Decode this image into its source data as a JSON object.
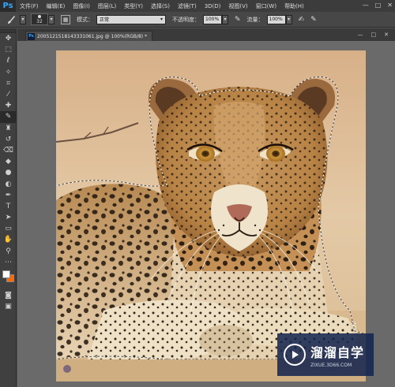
{
  "app": {
    "logo": "Ps"
  },
  "menu": [
    "文件(F)",
    "编辑(E)",
    "图像(I)",
    "图层(L)",
    "类型(Y)",
    "选择(S)",
    "滤镜(T)",
    "3D(D)",
    "视图(V)",
    "窗口(W)",
    "帮助(H)"
  ],
  "window_controls": {
    "minimize": "—",
    "restore": "□",
    "close": "✕"
  },
  "options": {
    "brush_size": "32",
    "mode_label": "模式：",
    "mode_value": "正常",
    "opacity_label": "不透明度：",
    "opacity_value": "100%",
    "flow_label": "流量：",
    "flow_value": "100%"
  },
  "document": {
    "icon": "Ps",
    "title": "2005121518143331061.jpg @ 100%(RGB/8) *",
    "close": "×",
    "controls": {
      "minimize": "—",
      "restore": "□",
      "close": "✕"
    }
  },
  "colors": {
    "foreground": "#ffffff",
    "background": "#ff6a00"
  },
  "watermark": {
    "cn": "溜溜自学",
    "en": "ZIXUE.3D66.COM"
  }
}
